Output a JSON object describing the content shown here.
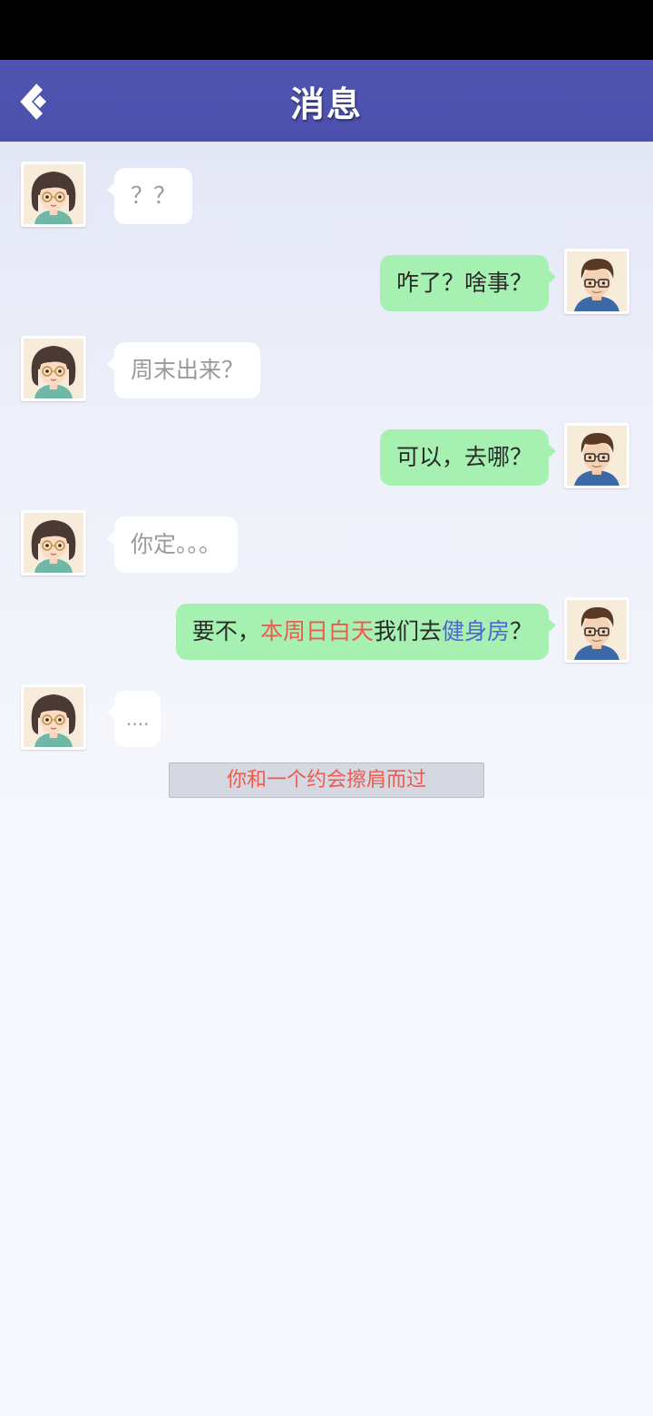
{
  "header": {
    "title": "消息",
    "back_icon": "back-chevron-icon"
  },
  "colors": {
    "header_bg": "#4f55b0",
    "incoming_bubble": "#ffffff",
    "outgoing_bubble": "#a6f0b1",
    "highlight_red": "#ec5a50",
    "highlight_blue": "#5264d4"
  },
  "messages": [
    {
      "sender": "girlfriend",
      "avatar": "girl-avatar-icon",
      "text": "？？"
    },
    {
      "sender": "me",
      "avatar": "boy-avatar-icon",
      "text": "咋了？啥事？"
    },
    {
      "sender": "girlfriend",
      "avatar": "girl-avatar-icon",
      "text": "周末出来？"
    },
    {
      "sender": "me",
      "avatar": "boy-avatar-icon",
      "text": "可以，去哪？"
    },
    {
      "sender": "girlfriend",
      "avatar": "girl-avatar-icon",
      "text": "你定。。。"
    },
    {
      "sender": "me",
      "avatar": "boy-avatar-icon",
      "segments": [
        {
          "text": "要不，",
          "style": "normal"
        },
        {
          "text": "本周日白天",
          "style": "red"
        },
        {
          "text": "我们去",
          "style": "normal"
        },
        {
          "text": "健身房",
          "style": "blue"
        },
        {
          "text": "？",
          "style": "normal"
        }
      ]
    },
    {
      "sender": "girlfriend",
      "avatar": "girl-avatar-icon",
      "text": "...."
    }
  ],
  "system_notice": "你和一个约会擦肩而过"
}
